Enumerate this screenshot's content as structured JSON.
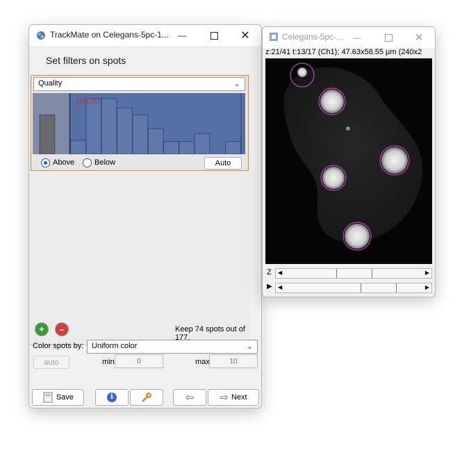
{
  "trackmate_window": {
    "title": "TrackMate on Celegans-5pc-1...",
    "panel_title": "Set filters on spots",
    "filter": {
      "feature": "Quality",
      "threshold_label": "200.00",
      "threshold_fraction": 0.15,
      "histogram_counts": [
        34,
        0,
        12,
        48,
        48,
        40,
        34,
        22,
        11,
        11,
        18,
        0,
        11
      ],
      "above_label": "Above",
      "below_label": "Below",
      "selected": "Above",
      "auto_label": "Auto"
    },
    "add_filter_icon": "plus-icon",
    "remove_filter_icon": "minus-icon",
    "status_text": "Keep 74 spots out of  177.",
    "color_spots_label": "Color spots by:",
    "color_mode": "Uniform color",
    "auto_button": "auto",
    "min_label": "min",
    "min_value": "0",
    "max_label": "max",
    "max_value": "10",
    "buttons": {
      "save": "Save",
      "next": "Next"
    }
  },
  "image_window": {
    "title": "Celegans-5pc-...",
    "info": "z:21/41 t:13/17 (Ch1); 47.63x58.55 µm (240x2",
    "z_label": "Z",
    "z_position": 0.5,
    "t_position": 0.73,
    "play_icon": "play-icon"
  },
  "colors": {
    "accent_orange": "#e08a2f",
    "histogram_bg": "#5570a5",
    "spot_circle": "#c040c0",
    "threshold_text": "#c03030"
  }
}
